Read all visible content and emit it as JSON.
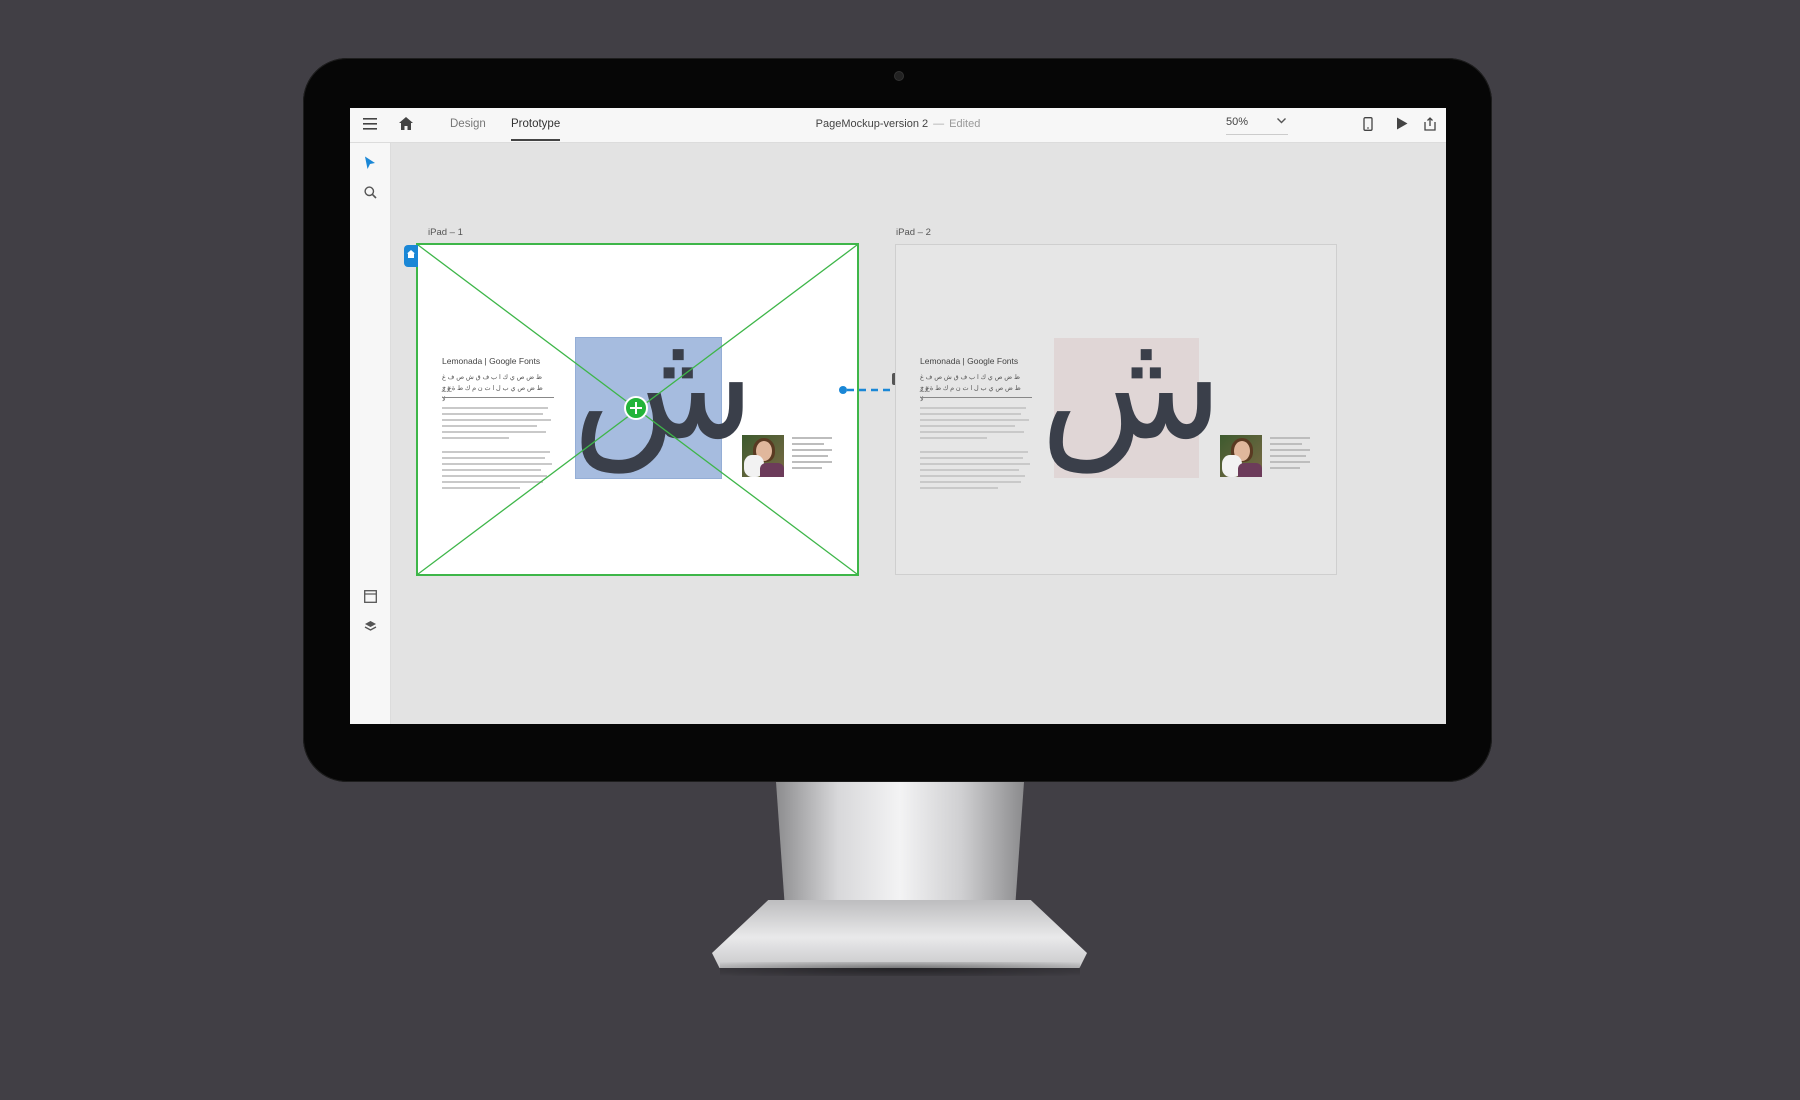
{
  "toolbar": {
    "tabs": [
      {
        "label": "Design",
        "active": false
      },
      {
        "label": "Prototype",
        "active": true
      }
    ],
    "document_title": "PageMockup-version 2",
    "separator": "—",
    "status": "Edited",
    "zoom": "50%",
    "icons": [
      "menu-icon",
      "home-icon",
      "device-preview-icon",
      "play-icon",
      "share-icon"
    ]
  },
  "sidebar": {
    "tools": [
      "select-arrow-icon",
      "zoom-search-icon"
    ],
    "panels": [
      "assets-icon",
      "layers-icon"
    ]
  },
  "artboards": [
    {
      "label": "iPad – 1",
      "heading": "Lemonada | Google Fonts",
      "arabic_line1": "ظ ض ص ي ك ا ب ف ق ش ص ف غ ع خ",
      "arabic_line2": "ظ ض ص ي ب ل ا ت ن م ك ط ة ؤ ز لا",
      "glyph": "ش",
      "selected": true
    },
    {
      "label": "iPad – 2",
      "heading": "Lemonada | Google Fonts",
      "arabic_line1": "ظ ض ص ي ك ا ب ف ق ش ص ف غ ع خ",
      "arabic_line2": "ظ ض ص ي ب ل ا ت ن م ك ط ة ؤ ز لا",
      "glyph": "ش",
      "selected": false
    }
  ],
  "colors": {
    "selection_green": "#3eb649",
    "link_blue": "#1a87d6",
    "hotspot_blue": "#5f86c6",
    "pink_box": "#e0d6d6"
  }
}
